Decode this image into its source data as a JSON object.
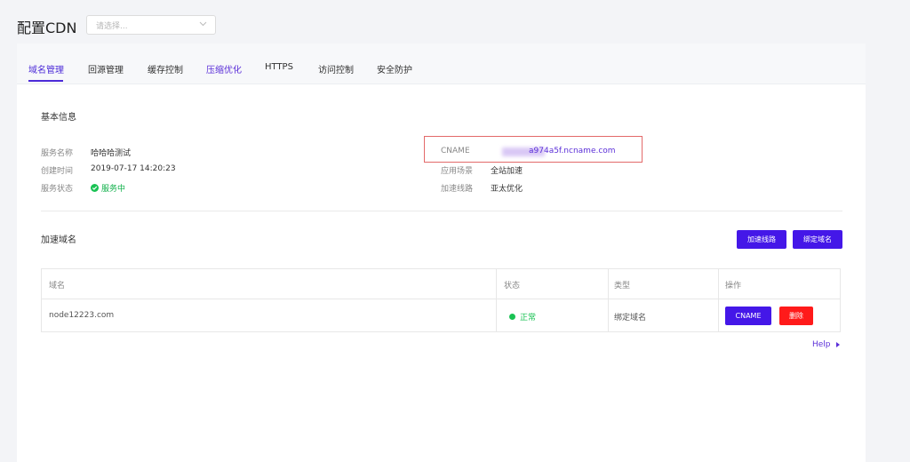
{
  "header": {
    "title": "配置CDN",
    "select_placeholder": "请选择..."
  },
  "tabs": [
    {
      "label": "域名管理"
    },
    {
      "label": "回源管理"
    },
    {
      "label": "缓存控制"
    },
    {
      "label": "压缩优化"
    },
    {
      "label": "HTTPS"
    },
    {
      "label": "访问控制"
    },
    {
      "label": "安全防护"
    }
  ],
  "basic_info": {
    "title": "基本信息",
    "service_name_label": "服务名称",
    "service_name_value": "哈哈哈测试",
    "created_label": "创建时间",
    "created_value": "2019-07-17 14:20:23",
    "status_label": "服务状态",
    "status_value": "服务中",
    "cname_label": "CNAME",
    "cname_value": "a974a5f.ncname.com",
    "scene_label": "应用场景",
    "scene_value": "全站加速",
    "route_label": "加速线路",
    "route_value": "亚太优化"
  },
  "domains": {
    "title": "加速域名",
    "route_button": "加速线路",
    "bind_button": "绑定域名",
    "columns": [
      "域名",
      "状态",
      "类型",
      "操作"
    ],
    "rows": [
      {
        "domain": "node12223.com",
        "status": "正常",
        "type": "绑定域名",
        "cname_button": "CNAME",
        "delete_button": "删除"
      }
    ],
    "help": "Help"
  },
  "colors": {
    "accent": "#4417e8",
    "danger": "#ff1a1a",
    "success": "#19c253",
    "highlight_border": "#e36a6a"
  }
}
